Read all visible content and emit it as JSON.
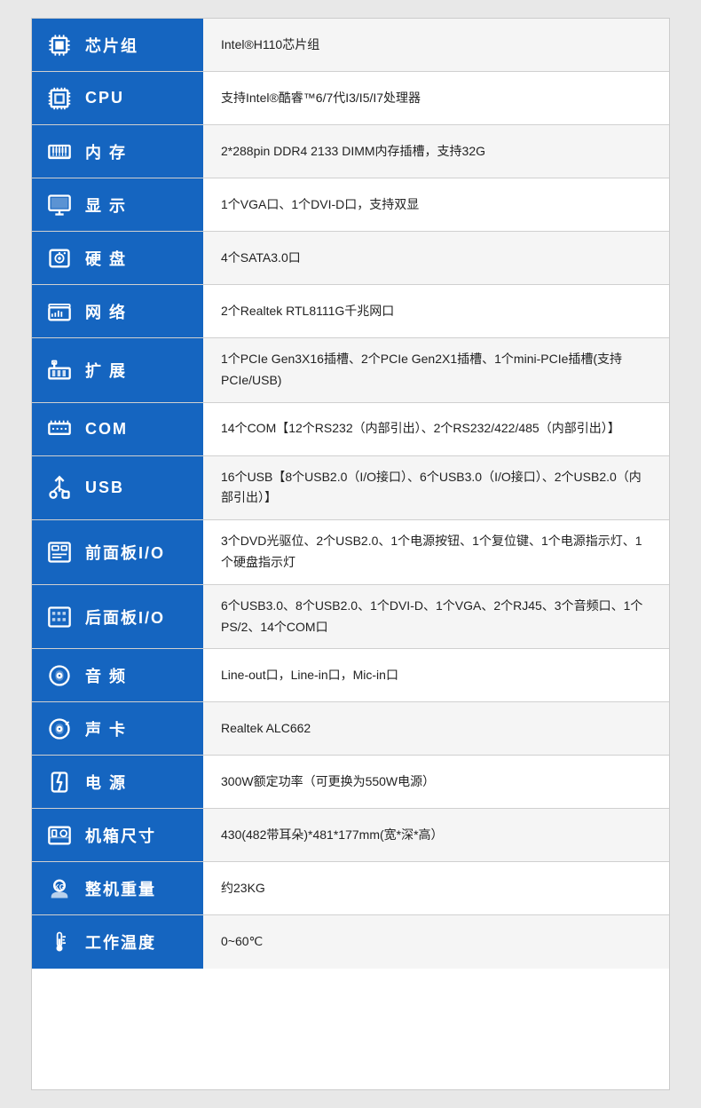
{
  "rows": [
    {
      "id": "chipset",
      "icon": "chipset",
      "label": "芯片组",
      "value": "Intel®H110芯片组"
    },
    {
      "id": "cpu",
      "icon": "cpu",
      "label": "CPU",
      "value": "支持Intel®酷睿™6/7代I3/I5/I7处理器"
    },
    {
      "id": "memory",
      "icon": "memory",
      "label": "内 存",
      "value": "2*288pin DDR4 2133 DIMM内存插槽，支持32G"
    },
    {
      "id": "display",
      "icon": "display",
      "label": "显 示",
      "value": "1个VGA口、1个DVI-D口，支持双显"
    },
    {
      "id": "harddisk",
      "icon": "harddisk",
      "label": "硬 盘",
      "value": "4个SATA3.0口"
    },
    {
      "id": "network",
      "icon": "network",
      "label": "网 络",
      "value": "2个Realtek RTL8111G千兆网口"
    },
    {
      "id": "expansion",
      "icon": "expansion",
      "label": "扩 展",
      "value": "1个PCIe Gen3X16插槽、2个PCIe Gen2X1插槽、1个mini-PCIe插槽(支持PCIe/USB)"
    },
    {
      "id": "com",
      "icon": "com",
      "label": "COM",
      "value": "14个COM【12个RS232（内部引出）、2个RS232/422/485（内部引出）】"
    },
    {
      "id": "usb",
      "icon": "usb",
      "label": "USB",
      "value": "16个USB【8个USB2.0（I/O接口）、6个USB3.0（I/O接口）、2个USB2.0（内部引出）】"
    },
    {
      "id": "front-panel",
      "icon": "front-panel",
      "label": "前面板I/O",
      "value": "3个DVD光驱位、2个USB2.0、1个电源按钮、1个复位键、1个电源指示灯、1个硬盘指示灯"
    },
    {
      "id": "rear-panel",
      "icon": "rear-panel",
      "label": "后面板I/O",
      "value": "6个USB3.0、8个USB2.0、1个DVI-D、1个VGA、2个RJ45、3个音频口、1个PS/2、14个COM口"
    },
    {
      "id": "audio",
      "icon": "audio",
      "label": "音 频",
      "value": "Line-out口，Line-in口，Mic-in口"
    },
    {
      "id": "soundcard",
      "icon": "soundcard",
      "label": "声 卡",
      "value": "Realtek ALC662"
    },
    {
      "id": "power",
      "icon": "power",
      "label": "电 源",
      "value": "300W额定功率（可更换为550W电源）"
    },
    {
      "id": "chassis",
      "icon": "chassis",
      "label": "机箱尺寸",
      "value": "430(482带耳朵)*481*177mm(宽*深*高）"
    },
    {
      "id": "weight",
      "icon": "weight",
      "label": "整机重量",
      "value": "约23KG"
    },
    {
      "id": "temperature",
      "icon": "temperature",
      "label": "工作温度",
      "value": "0~60℃"
    }
  ]
}
